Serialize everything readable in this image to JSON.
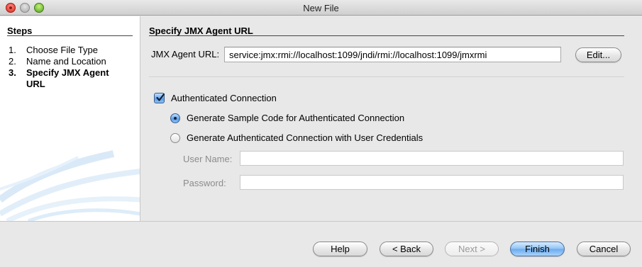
{
  "window": {
    "title": "New File"
  },
  "steps": {
    "header": "Steps",
    "items": [
      {
        "num": "1.",
        "label": "Choose File Type",
        "current": false
      },
      {
        "num": "2.",
        "label": "Name and Location",
        "current": false
      },
      {
        "num": "3.",
        "label": "Specify JMX Agent URL",
        "current": true
      }
    ]
  },
  "main": {
    "section_title": "Specify JMX Agent URL",
    "url_label": "JMX Agent URL:",
    "url_value": "service:jmx:rmi://localhost:1099/jndi/rmi://localhost:1099/jmxrmi",
    "edit_label": "Edit...",
    "auth_checkbox_label": "Authenticated Connection",
    "auth_checked": true,
    "radio_sample_label": "Generate Sample Code for Authenticated Connection",
    "radio_credentials_label": "Generate Authenticated Connection with User Credentials",
    "selected_radio": "sample",
    "user_name_label": "User Name:",
    "user_name_value": "",
    "password_label": "Password:",
    "password_value": ""
  },
  "footer": {
    "help_label": "Help",
    "back_label": "< Back",
    "next_label": "Next >",
    "finish_label": "Finish",
    "cancel_label": "Cancel"
  },
  "colors": {
    "accent": "#6aaaf0",
    "panel_bg": "#e8e8e8",
    "steps_bg": "#ffffff"
  }
}
